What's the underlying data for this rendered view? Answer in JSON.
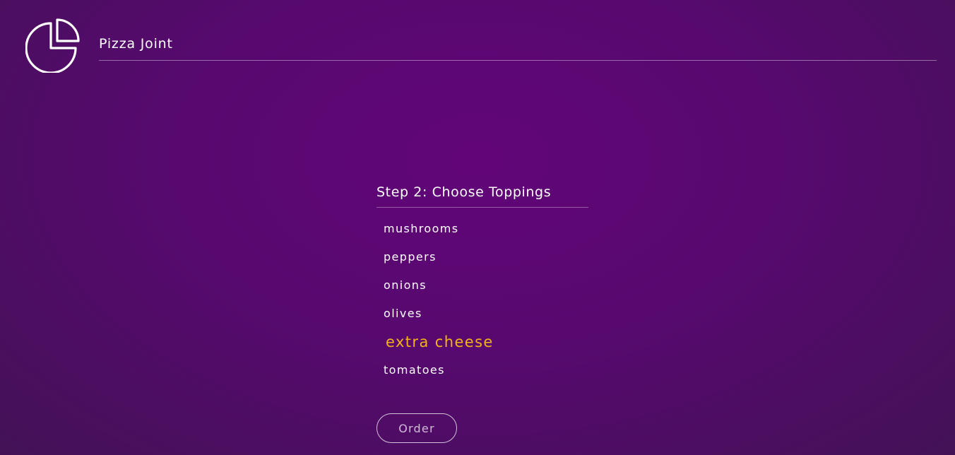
{
  "brand": {
    "name": "Pizza Joint",
    "logo_icon": "pizza-slice-icon"
  },
  "step": {
    "title": "Step 2: Choose Toppings",
    "toppings": [
      {
        "label": "mushrooms",
        "selected": false
      },
      {
        "label": "peppers",
        "selected": false
      },
      {
        "label": "onions",
        "selected": false
      },
      {
        "label": "olives",
        "selected": false
      },
      {
        "label": "extra cheese",
        "selected": true
      },
      {
        "label": "tomatoes",
        "selected": false
      }
    ]
  },
  "actions": {
    "order_label": "Order"
  },
  "colors": {
    "background": "#5a0a70",
    "accent": "#f3b21a",
    "text": "#ffffff"
  }
}
